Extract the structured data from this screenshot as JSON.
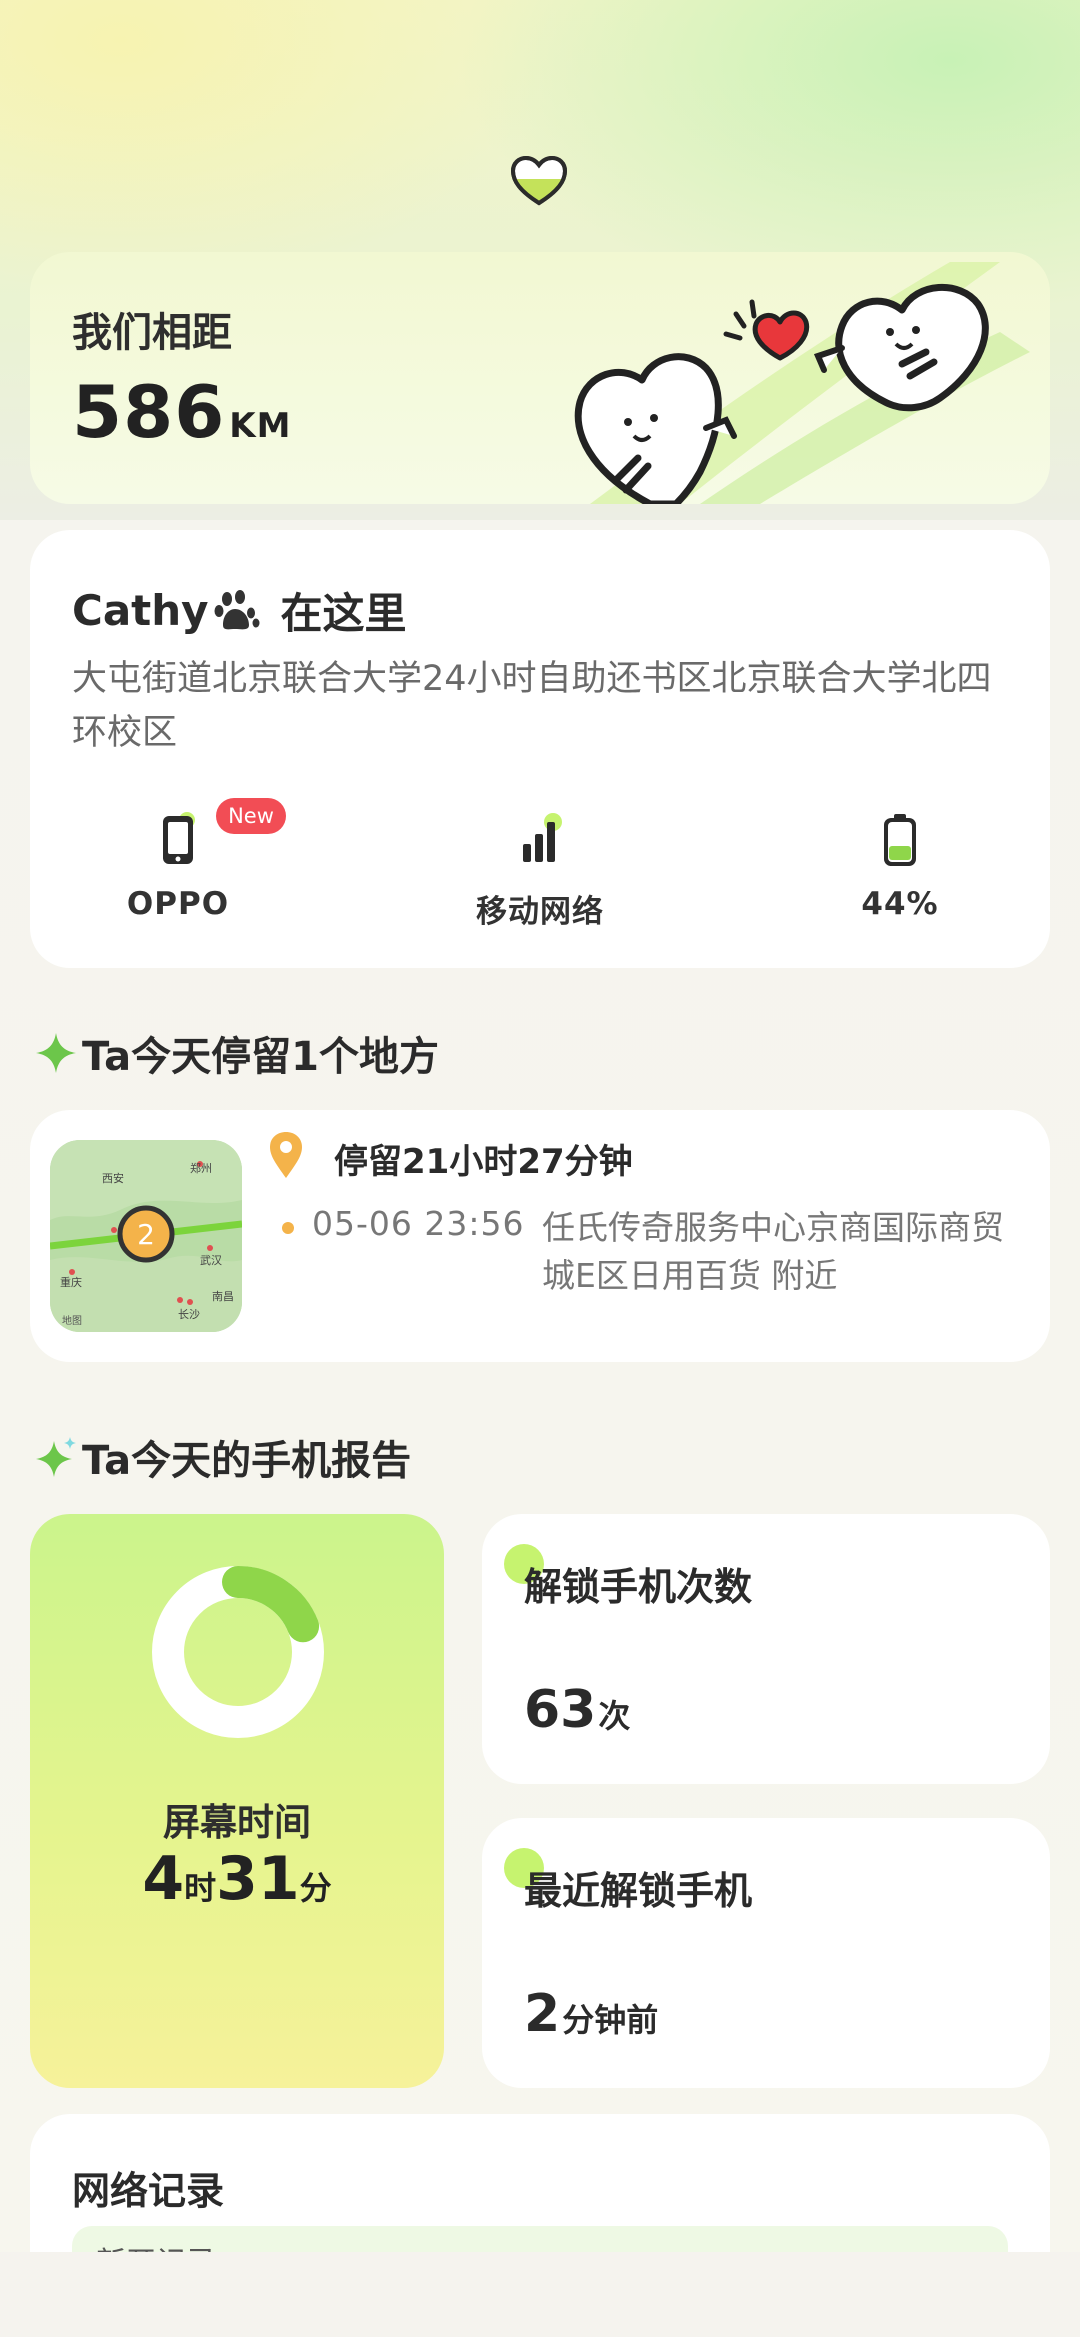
{
  "distance": {
    "title": "我们相距",
    "value": "586",
    "unit": "KM"
  },
  "location": {
    "name": "Cathy",
    "here_label": "在这里",
    "address": "大屯街道北京联合大学24小时自助还书区北京联合大学北四环校区",
    "device": {
      "label": "OPPO",
      "badge": "New"
    },
    "network": {
      "label": "移动网络"
    },
    "battery": {
      "label": "44%",
      "level": 0.44
    }
  },
  "stay_section": {
    "title": "Ta今天停留1个地方"
  },
  "stay": {
    "count": "2",
    "duration": "停留21小时27分钟",
    "time": "05-06 23:56",
    "place": "任氏传奇服务中心京商国际商贸城E区日用百货 附近",
    "map_labels": [
      "西安",
      "郑州",
      "重庆",
      "武汉",
      "长沙",
      "南昌",
      "地图"
    ]
  },
  "report_section": {
    "title": "Ta今天的手机报告"
  },
  "screen_time": {
    "label": "屏幕时间",
    "hours": "4",
    "hours_unit": "时",
    "minutes": "31",
    "minutes_unit": "分",
    "ring_fraction": 0.19
  },
  "unlock_count": {
    "title": "解锁手机次数",
    "value": "63",
    "unit": "次"
  },
  "last_unlock": {
    "title": "最近解锁手机",
    "value": "2",
    "unit": "分钟前"
  },
  "network_log": {
    "title": "网络记录",
    "sub": "新开记录"
  },
  "colors": {
    "accent_green": "#8fd64a",
    "badge_red": "#f24d55",
    "pin_orange": "#f4b34a",
    "heart_red": "#e8373b"
  }
}
